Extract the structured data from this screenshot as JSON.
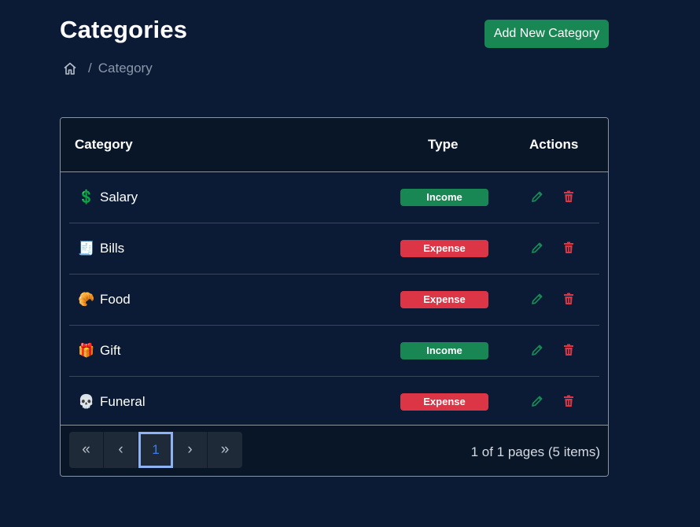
{
  "header": {
    "title": "Categories",
    "add_label": "Add New Category"
  },
  "breadcrumb": {
    "separator": "/",
    "current": "Category"
  },
  "table": {
    "columns": [
      "Category",
      "Type",
      "Actions"
    ],
    "rows": [
      {
        "emoji": "💲",
        "name": "Salary",
        "type": "Income"
      },
      {
        "emoji": "🧾",
        "name": "Bills",
        "type": "Expense"
      },
      {
        "emoji": "🥐",
        "name": "Food",
        "type": "Expense"
      },
      {
        "emoji": "🎁",
        "name": "Gift",
        "type": "Income"
      },
      {
        "emoji": "💀",
        "name": "Funeral",
        "type": "Expense"
      }
    ]
  },
  "pager": {
    "first": "«",
    "prev": "‹",
    "current": "1",
    "next": "›",
    "last": "»",
    "info": "1 of 1 pages (5 items)"
  },
  "colors": {
    "background": "#0b1b36",
    "income": "#198754",
    "expense": "#dc3545",
    "edit_icon": "#198754",
    "delete_icon": "#dc3545"
  },
  "icons": {
    "home": "home-icon",
    "edit": "pencil-icon",
    "delete": "trash-icon"
  }
}
